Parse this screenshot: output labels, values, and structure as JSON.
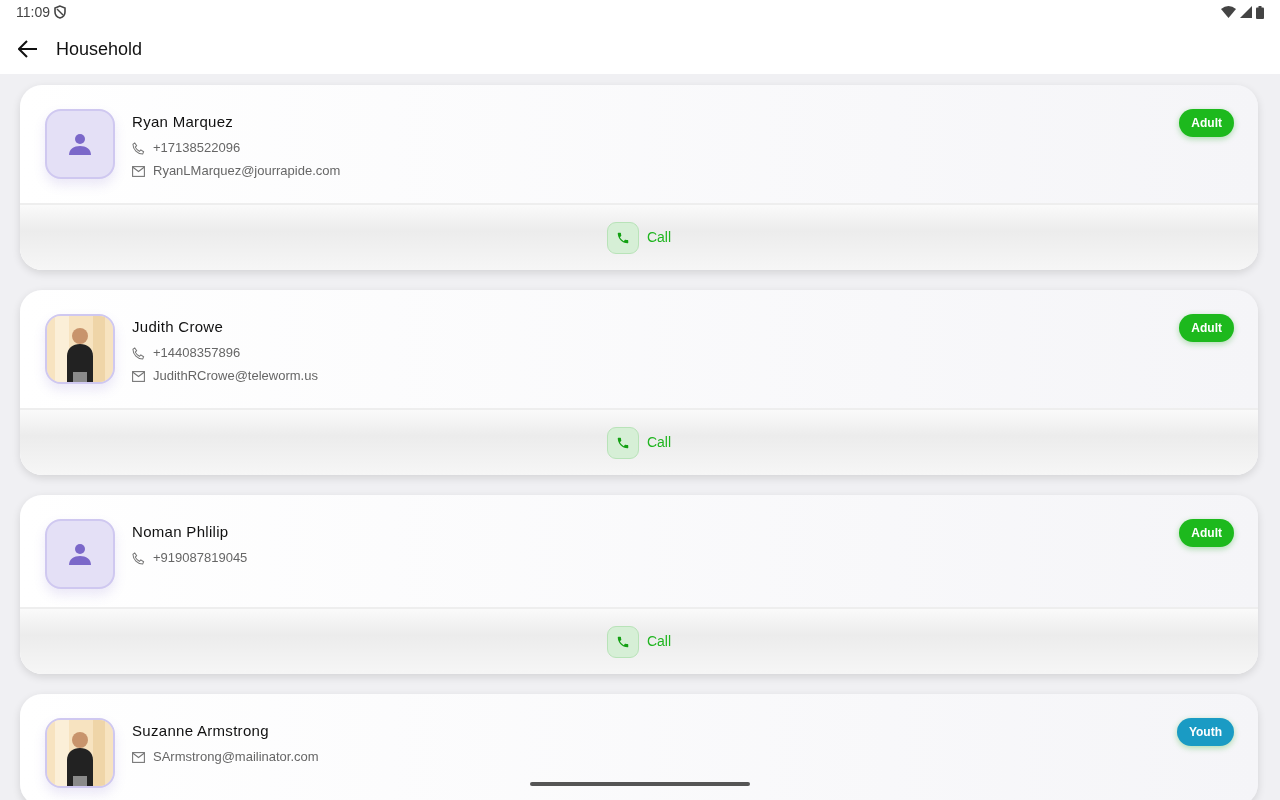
{
  "status_bar": {
    "time": "11:09"
  },
  "app_bar": {
    "title": "Household"
  },
  "members": [
    {
      "name": "Ryan Marquez",
      "avatar": {
        "kind": "placeholder"
      },
      "phone": "+17138522096",
      "email": "RyanLMarquez@jourrapide.com",
      "badge": {
        "label": "Adult",
        "color": "#1db91d"
      },
      "action": "Call"
    },
    {
      "name": "Judith Crowe",
      "phone": "+14408357896",
      "email": "JudithRCrowe@teleworm.us",
      "badge": {
        "label": "Adult",
        "color": "#1db91d"
      },
      "action": "Call"
    },
    {
      "name": "Noman Phlilip",
      "avatar": {
        "kind": "placeholder"
      },
      "phone": "+919087819045",
      "badge": {
        "label": "Adult",
        "color": "#1db91d"
      },
      "action": "Call"
    },
    {
      "name": "Suzanne Armstrong",
      "email": "SArmstrong@mailinator.com",
      "badge": {
        "label": "Youth",
        "color": "#1a9bc4"
      }
    }
  ]
}
